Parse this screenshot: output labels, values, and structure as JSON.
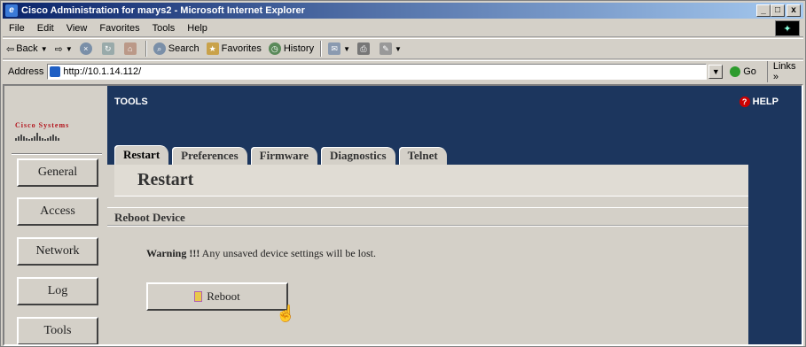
{
  "window": {
    "title": "Cisco Administration for marys2 - Microsoft Internet Explorer",
    "controls": [
      "_",
      "□",
      "x"
    ]
  },
  "menu": [
    "File",
    "Edit",
    "View",
    "Favorites",
    "Tools",
    "Help"
  ],
  "toolbar": {
    "back": "Back",
    "search": "Search",
    "favorites": "Favorites",
    "history": "History"
  },
  "address": {
    "label": "Address",
    "value": "http://10.1.14.112/",
    "go": "Go",
    "links": "Links »"
  },
  "app": {
    "brand": "Cisco Systems",
    "section_title": "TOOLS",
    "help": "HELP",
    "nav": [
      "General",
      "Access",
      "Network",
      "Log",
      "Tools"
    ],
    "tabs": [
      "Restart",
      "Preferences",
      "Firmware",
      "Diagnostics",
      "Telnet"
    ],
    "active_tab": "Restart",
    "content_title": "Restart",
    "section": "Reboot Device",
    "warning_strong": "Warning !!!",
    "warning_text": " Any unsaved device settings will be lost.",
    "reboot_label": "Reboot"
  },
  "colors": {
    "page_bg": "#1c365e",
    "panel": "#d4d0c8",
    "cisco_red": "#b3131c"
  }
}
